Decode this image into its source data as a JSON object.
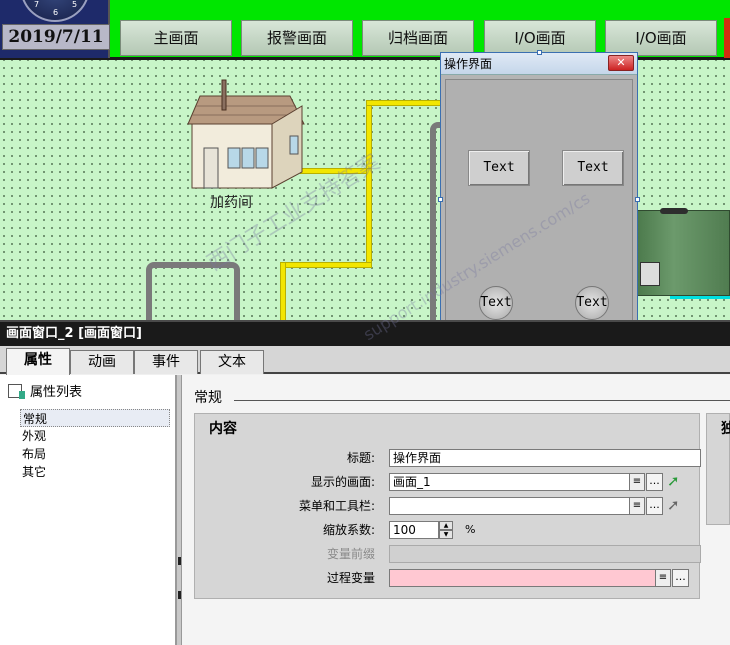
{
  "hmi": {
    "date": "2019/7/11",
    "clock_numbers": [
      "7",
      "6",
      "5"
    ],
    "nav_buttons": [
      "主画面",
      "报警画面",
      "归档画面",
      "I/O画面",
      "I/O画面"
    ],
    "house_label": "加药间",
    "op_window": {
      "title": "操作界面",
      "buttons": [
        "Text",
        "Text"
      ],
      "round_buttons": [
        "Text",
        "Text"
      ]
    }
  },
  "panel": {
    "title": "画面窗口_2 [画面窗口]",
    "tabs": [
      "属性",
      "动画",
      "事件",
      "文本"
    ],
    "active_tab": "属性",
    "property_list_label": "属性列表",
    "categories": [
      "常规",
      "外观",
      "布局",
      "其它"
    ],
    "selected_category": "常规",
    "section": "常规",
    "content_heading": "内容",
    "side_heading": "独",
    "fields": {
      "title_label": "标题:",
      "title_value": "操作界面",
      "screen_label": "显示的画面:",
      "screen_value": "画面_1",
      "menu_label": "菜单和工具栏:",
      "menu_value": "",
      "scale_label": "缩放系数:",
      "scale_value": "100",
      "scale_unit": "%",
      "prefix_label": "变量前缀",
      "prefix_value": "",
      "process_var_label": "过程变量",
      "process_var_value": ""
    }
  },
  "watermark": {
    "line1": "西门子工业支持答案",
    "line2": "support.industry.siemens.com/cs"
  },
  "colors": {
    "topbar": "#00e600",
    "canvas": "#c8f5c8",
    "pipe_yellow": "#f2e600",
    "pipe_gray": "#7a7a7a",
    "tank_green": "#5c8a5c",
    "process_var_field": "#ffc8d2"
  }
}
